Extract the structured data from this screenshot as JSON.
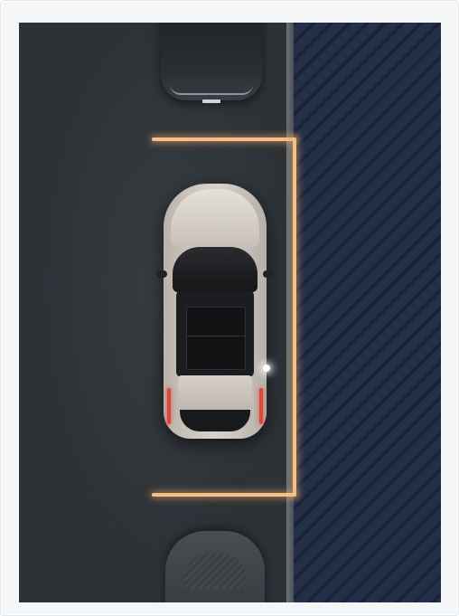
{
  "scene": {
    "type": "parking-assist-overhead-view",
    "guide_color": "#f2c089",
    "road_color": "#2c3136",
    "sidewalk_color": "#1f2a3f"
  },
  "icons": {
    "parking_guide": "parking-slot-bracket",
    "ego_vehicle": "car-top-view",
    "parked_vehicle_front": "car-top-view",
    "parked_vehicle_rear": "car-top-view"
  }
}
